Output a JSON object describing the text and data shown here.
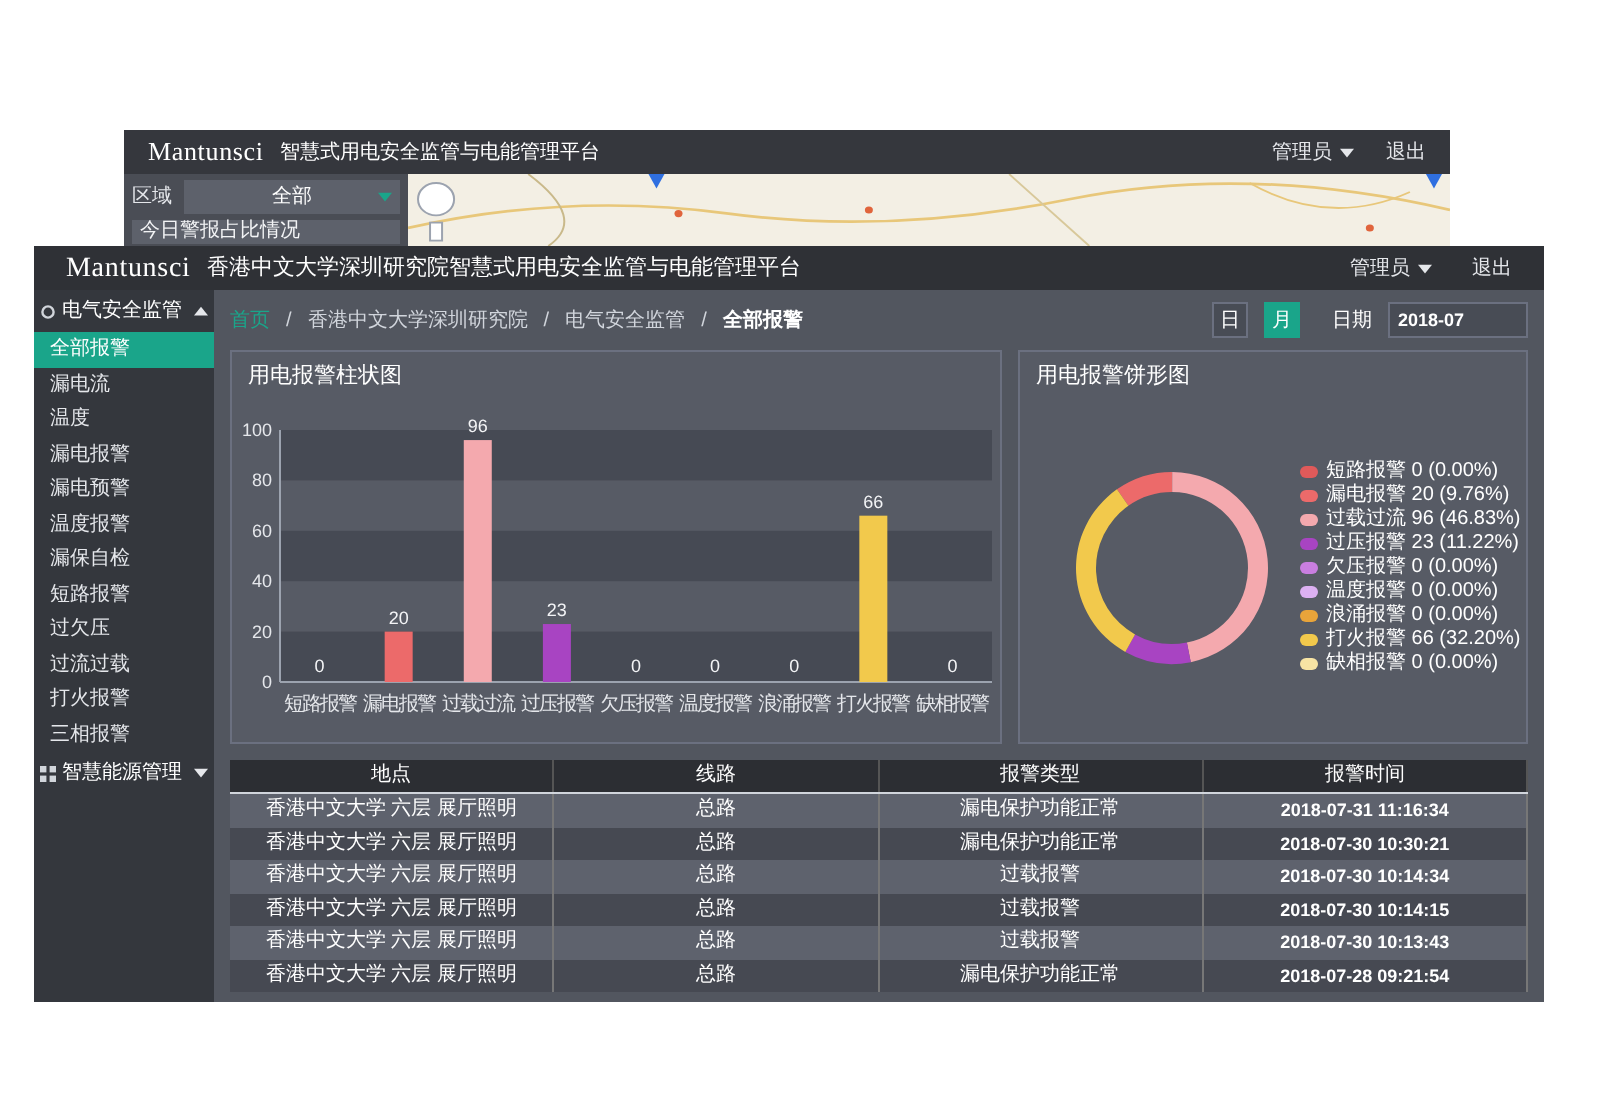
{
  "back_window": {
    "logo": "Mantunsci",
    "title": "智慧式用电安全监管与电能管理平台",
    "user_menu": "管理员",
    "logout": "退出",
    "region_label": "区域",
    "region_select": "全部",
    "panel_title": "今日警报占比情况"
  },
  "front_window": {
    "logo": "Mantunsci",
    "title": "香港中文大学深圳研究院智慧式用电安全监管与电能管理平台",
    "user_menu": "管理员",
    "logout": "退出"
  },
  "sidebar": {
    "groups": [
      {
        "label": "电气安全监管",
        "expanded": true,
        "items": [
          {
            "label": "全部报警",
            "selected": true
          },
          {
            "label": "漏电流",
            "selected": false
          },
          {
            "label": "温度",
            "selected": false
          },
          {
            "label": "漏电报警",
            "selected": false
          },
          {
            "label": "漏电预警",
            "selected": false
          },
          {
            "label": "温度报警",
            "selected": false
          },
          {
            "label": "漏保自检",
            "selected": false
          },
          {
            "label": "短路报警",
            "selected": false
          },
          {
            "label": "过欠压",
            "selected": false
          },
          {
            "label": "过流过载",
            "selected": false
          },
          {
            "label": "打火报警",
            "selected": false
          },
          {
            "label": "三相报警",
            "selected": false
          }
        ]
      },
      {
        "label": "智慧能源管理",
        "expanded": false
      }
    ]
  },
  "breadcrumb": {
    "separator": "/",
    "items": [
      "首页",
      "香港中文大学深圳研究院",
      "电气安全监管",
      "全部报警"
    ]
  },
  "period_buttons": [
    {
      "label": "日",
      "selected": false
    },
    {
      "label": "月",
      "selected": true
    }
  ],
  "date_filter": {
    "label": "日期",
    "value": "2018-07"
  },
  "bar_panel": {
    "chart_data": {
      "type": "bar",
      "title": "用电报警柱状图",
      "categories": [
        "短路报警",
        "漏电报警",
        "过载过流",
        "过压报警",
        "欠压报警",
        "温度报警",
        "浪涌报警",
        "打火报警",
        "缺相报警"
      ],
      "values": [
        0,
        20,
        96,
        23,
        0,
        0,
        0,
        66,
        0
      ],
      "ylim": [
        0,
        100
      ],
      "yticks": [
        0,
        20,
        40,
        60,
        80,
        100
      ],
      "data_labels": true
    }
  },
  "pie_panel": {
    "chart_data": {
      "type": "donut",
      "title": "用电报警饼形图",
      "values": [
        0,
        9.76,
        46.83,
        11.22,
        0,
        0,
        0,
        32.2,
        0
      ]
    },
    "legend": [
      {
        "label": "短路报警 0 (0.00%)",
        "color": "#e05a5a"
      },
      {
        "label": "漏电报警 20 (9.76%)",
        "color": "#ec6a6a"
      },
      {
        "label": "过载过流 96 (46.83%)",
        "color": "#f4a9ae"
      },
      {
        "label": "过压报警 23 (11.22%)",
        "color": "#a844c2"
      },
      {
        "label": "欠压报警 0 (0.00%)",
        "color": "#c97ee0"
      },
      {
        "label": "温度报警 0 (0.00%)",
        "color": "#dcb0f2"
      },
      {
        "label": "浪涌报警 0 (0.00%)",
        "color": "#e8a43a"
      },
      {
        "label": "打火报警 66 (32.20%)",
        "color": "#f2c94c"
      },
      {
        "label": "缺相报警 0 (0.00%)",
        "color": "#f7e4a4"
      }
    ]
  },
  "table": {
    "columns": [
      "地点",
      "线路",
      "报警类型",
      "报警时间"
    ],
    "rows": [
      [
        "香港中文大学 六层 展厅照明",
        "总路",
        "漏电保护功能正常",
        "2018-07-31 11:16:34"
      ],
      [
        "香港中文大学 六层 展厅照明",
        "总路",
        "漏电保护功能正常",
        "2018-07-30 10:30:21"
      ],
      [
        "香港中文大学 六层 展厅照明",
        "总路",
        "过载报警",
        "2018-07-30 10:14:34"
      ],
      [
        "香港中文大学 六层 展厅照明",
        "总路",
        "过载报警",
        "2018-07-30 10:14:15"
      ],
      [
        "香港中文大学 六层 展厅照明",
        "总路",
        "过载报警",
        "2018-07-30 10:13:43"
      ],
      [
        "香港中文大学 六层 展厅照明",
        "总路",
        "漏电保护功能正常",
        "2018-07-28 09:21:54"
      ]
    ]
  }
}
